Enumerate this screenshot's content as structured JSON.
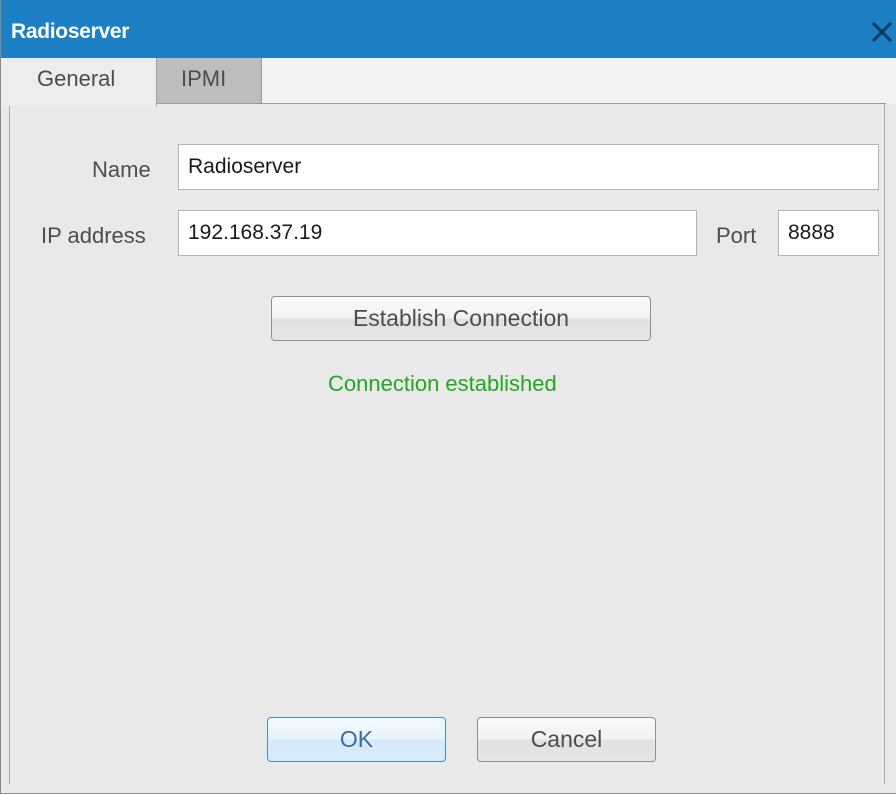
{
  "window": {
    "title": "Radioserver"
  },
  "tabs": [
    {
      "label": "General",
      "active": true
    },
    {
      "label": "IPMI",
      "active": false
    }
  ],
  "form": {
    "name_label": "Name",
    "name_value": "Radioserver",
    "ip_label": "IP address",
    "ip_value": "192.168.37.19",
    "port_label": "Port",
    "port_value": "8888",
    "establish_label": "Establish Connection",
    "status_text": "Connection established",
    "status_color": "#22a822"
  },
  "footer": {
    "ok_label": "OK",
    "cancel_label": "Cancel"
  },
  "icons": {
    "close": "close-icon"
  },
  "colors": {
    "titlebar": "#1d7fc4",
    "ok_border": "#3c8fd6"
  }
}
